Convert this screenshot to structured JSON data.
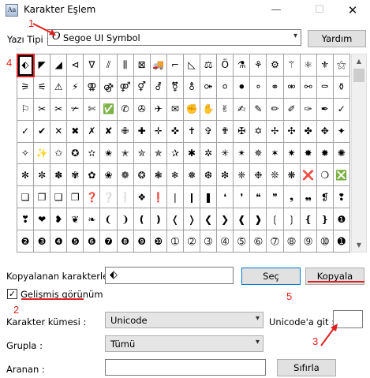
{
  "window": {
    "title": "Karakter Eşlem",
    "minimize_glyph": "—",
    "maximize_glyph": "☐",
    "close_glyph": "✕"
  },
  "font": {
    "label": "Yazı Tipi :",
    "value": "Segoe UI Symbol",
    "glyph": "O",
    "help_button": "Yardım"
  },
  "grid": {
    "rows": [
      [
        "⬖",
        "◤",
        "◢",
        "⊲",
        "∇",
        "⫽",
        "⫼",
        "⊠",
        "🚚",
        "⌐",
        "◺",
        "⚖",
        "Ö",
        "⚗",
        "⚘",
        "⚙",
        "⚚",
        "⚛",
        "⚜",
        "⚝"
      ],
      [
        "⚞",
        "⚟",
        "⚠",
        "⚡",
        "⚢",
        "⚣",
        "⚤",
        "⚥",
        "⚦",
        "⚧",
        "⚨",
        "⚩",
        "⚪",
        "⚫",
        "⚬",
        "⚭",
        "⚮",
        "⚯",
        "⚰",
        "⚱"
      ],
      [
        "⚐",
        "✂",
        "✂",
        "✃",
        "✄",
        "✅",
        "✆",
        "✇",
        "✈",
        "✉",
        "✊",
        "✋",
        "✌",
        "✍",
        "✎",
        "✏",
        "✐",
        "✑",
        "✒",
        "✓"
      ],
      [
        "✓",
        "✔",
        "✕",
        "✖",
        "✗",
        "✘",
        "✙",
        "✚",
        "✛",
        "✜",
        "✝",
        "✞",
        "✟",
        "✠",
        "✡",
        "✢",
        "✣",
        "✤",
        "✥",
        "✦"
      ],
      [
        "✧",
        "✨",
        "✩",
        "✪",
        "✫",
        "✬",
        "✭",
        "✮",
        "✯",
        "✰",
        "✱",
        "✲",
        "✳",
        "✴",
        "✵",
        "✶",
        "✷",
        "✸",
        "✹",
        "✺"
      ],
      [
        "✻",
        "✼",
        "✽",
        "✾",
        "✿",
        "❀",
        "❁",
        "❂",
        "❃",
        "❄",
        "❅",
        "❆",
        "❇",
        "❈",
        "❉",
        "❊",
        "❋",
        "❌",
        "❍",
        "❎"
      ],
      [
        "❏",
        "❐",
        "❑",
        "❒",
        "❓",
        "❔",
        "❕",
        "❖",
        "❗",
        "❘",
        "❙",
        "❚",
        "❛",
        "❜",
        "❝",
        "❞",
        "❟",
        "❠",
        "❡",
        "❢"
      ],
      [
        "❣",
        "❤",
        "❥",
        "❦",
        "❧",
        "❨",
        "❩",
        "❪",
        "❫",
        "❬",
        "❭",
        "❮",
        "❯",
        "❰",
        "❱",
        "❲",
        "❳",
        "❴",
        "❵",
        "❶"
      ],
      [
        "❷",
        "❸",
        "❹",
        "❺",
        "❻",
        "❼",
        "❽",
        "❾",
        "❿",
        "➀",
        "➁",
        "➂",
        "➃",
        "➄",
        "➅",
        "➆",
        "➇",
        "➈",
        "➉",
        "➊"
      ]
    ]
  },
  "copy": {
    "label": "Kopyalanan karakterler :",
    "value": "⬖",
    "select_button": "Seç",
    "copy_button": "Kopyala"
  },
  "advanced": {
    "checkbox_label": "Gelişmiş görünüm",
    "checked": true,
    "check_glyph": "✓",
    "charset_label": "Karakter kümesi :",
    "charset_value": "Unicode",
    "goto_label": "Unicode'a git :",
    "goto_value": "",
    "group_label": "Grupla :",
    "group_value": "Tümü",
    "search_label": "Aranan :",
    "search_value": "",
    "search_button": "Sıfırla"
  },
  "annotations": {
    "n1": "1",
    "n2": "2",
    "n3": "3",
    "n4": "4",
    "n5": "5",
    "color": "#e02020"
  },
  "icons": {
    "app": "character-map-icon",
    "arrow_down": "▾",
    "scroll_up": "▲",
    "scroll_down": "▼"
  }
}
